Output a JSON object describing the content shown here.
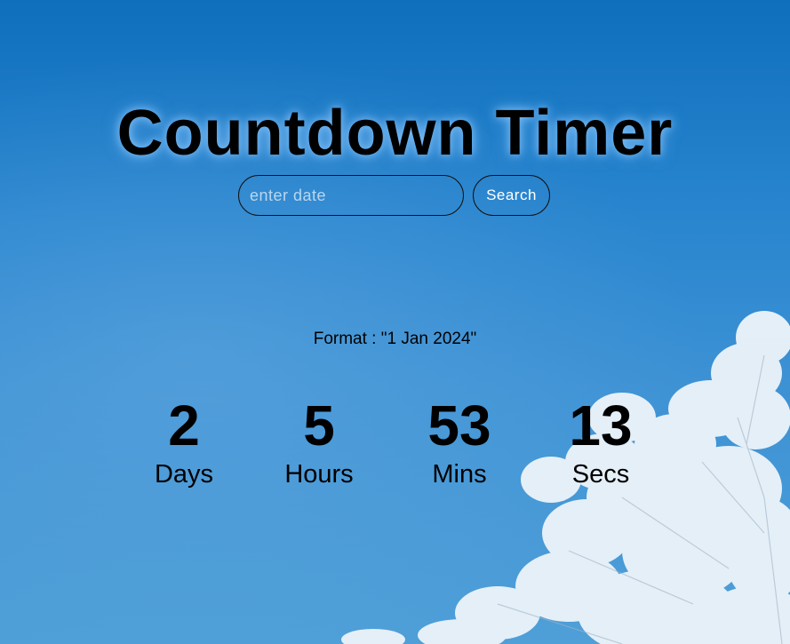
{
  "header": {
    "title": "Countdown Timer"
  },
  "search": {
    "placeholder": "enter date",
    "value": "",
    "button_label": "Search"
  },
  "format_hint": "Format : \"1 Jan 2024\"",
  "countdown": {
    "days": {
      "value": "2",
      "label": "Days"
    },
    "hours": {
      "value": "5",
      "label": "Hours"
    },
    "mins": {
      "value": "53",
      "label": "Mins"
    },
    "secs": {
      "value": "13",
      "label": "Secs"
    }
  },
  "colors": {
    "sky_top": "#0f6fbd",
    "sky_bottom": "#4f9fd8",
    "text": "#000000",
    "button_text": "#ffffff",
    "frost": "#f2f6fa"
  }
}
